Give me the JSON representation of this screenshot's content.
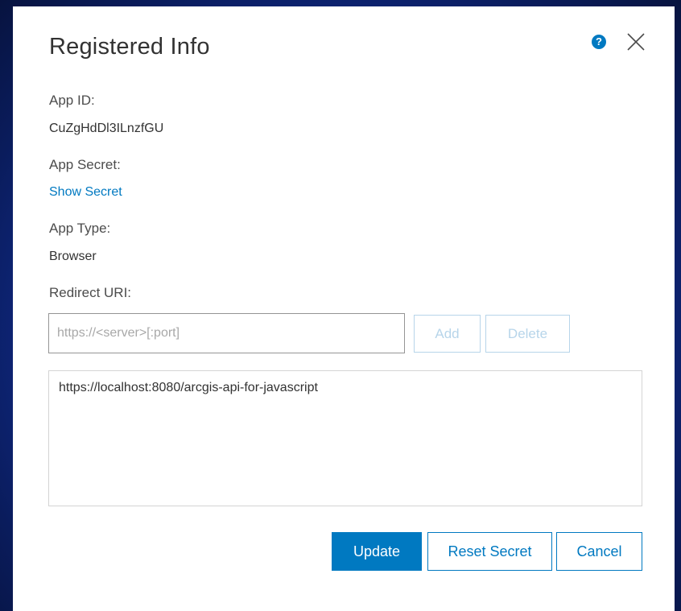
{
  "dialog": {
    "title": "Registered Info",
    "help_icon": "help-circle-icon",
    "close_icon": "close-icon",
    "help_glyph": "?"
  },
  "fields": {
    "app_id_label": "App ID:",
    "app_id_value": "CuZgHdDl3ILnzfGU",
    "app_secret_label": "App Secret:",
    "show_secret_link": "Show Secret",
    "app_type_label": "App Type:",
    "app_type_value": "Browser",
    "redirect_uri_label": "Redirect URI:"
  },
  "redirect": {
    "input_value": "",
    "input_placeholder": "https://<server>[:port]",
    "add_label": "Add",
    "delete_label": "Delete",
    "uris": [
      "https://localhost:8080/arcgis-api-for-javascript"
    ]
  },
  "actions": {
    "update_label": "Update",
    "reset_secret_label": "Reset Secret",
    "cancel_label": "Cancel"
  },
  "colors": {
    "accent": "#0079c1",
    "background": "#13309a",
    "disabled": "#b7d5ea"
  }
}
